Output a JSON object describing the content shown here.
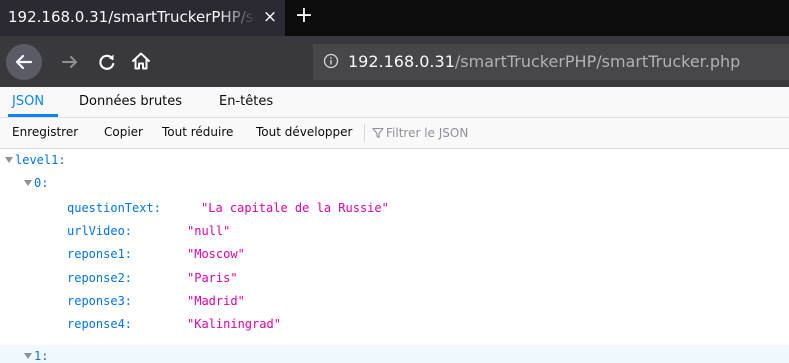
{
  "browser": {
    "tab_title": "192.168.0.31/smartTruckerPHP/smartTrucker.php",
    "close_glyph": "×",
    "new_tab_glyph": "+",
    "url_host": "192.168.0.31",
    "url_path": "/smartTruckerPHP/smartTrucker.php",
    "icons": [
      "back-icon",
      "forward-icon",
      "reload-icon",
      "home-icon",
      "info-icon"
    ]
  },
  "viewer_tabs": [
    {
      "label": "JSON",
      "active": true
    },
    {
      "label": "Données brutes",
      "active": false
    },
    {
      "label": "En-têtes",
      "active": false
    }
  ],
  "toolbar": {
    "save_label": "Enregistrer",
    "copy_label": "Copier",
    "collapse_label": "Tout réduire",
    "expand_label": "Tout développer",
    "filter_placeholder": "Filtrer le JSON"
  },
  "tree": {
    "root_key": "level1:",
    "items": [
      {
        "index_label": "0:",
        "fields": [
          {
            "key": "questionText:",
            "value": "\"La capitale de la Russie\""
          },
          {
            "key": "urlVideo:",
            "value": "\"null\""
          },
          {
            "key": "reponse1:",
            "value": "\"Moscow\""
          },
          {
            "key": "reponse2:",
            "value": "\"Paris\""
          },
          {
            "key": "reponse3:",
            "value": "\"Madrid\""
          },
          {
            "key": "reponse4:",
            "value": "\"Kaliningrad\""
          }
        ]
      },
      {
        "index_label": "1:",
        "fields": []
      }
    ]
  },
  "colors": {
    "tab_strip": "#0c0c0d",
    "nav_bar": "#38383d",
    "accent": "#0a84ff",
    "json_key": "#0074e8",
    "json_string": "#dd00a9"
  }
}
